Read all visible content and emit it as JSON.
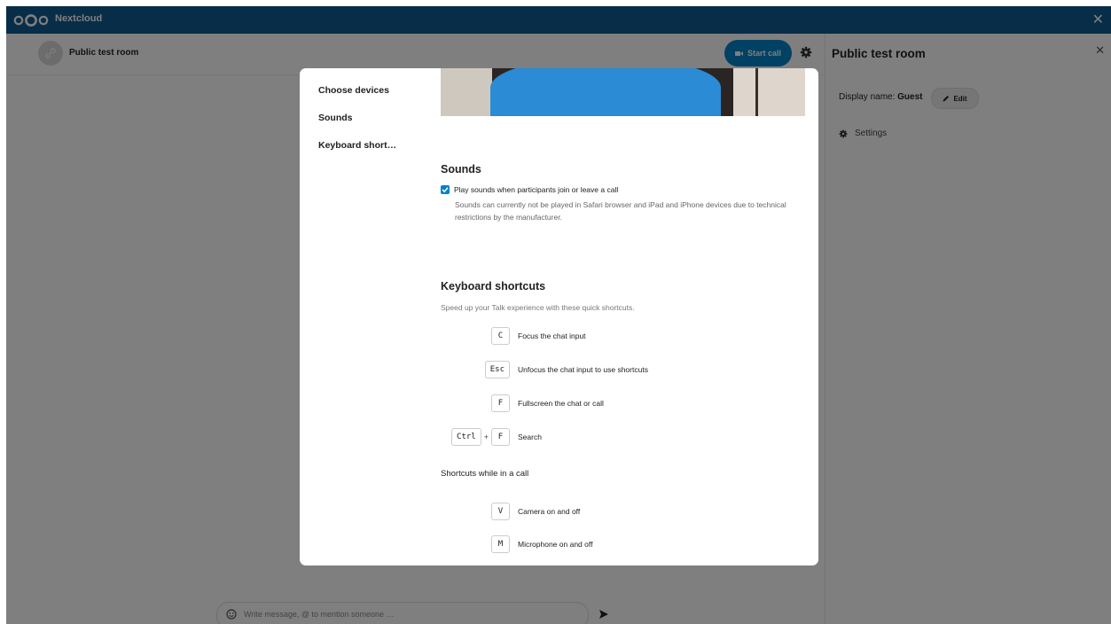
{
  "app": {
    "brand": "Nextcloud"
  },
  "chat": {
    "room_title": "Public test room",
    "start_call_label": "Start call",
    "input_placeholder": "Write message, @ to mention someone …"
  },
  "sidebar": {
    "title": "Public test room",
    "display_name_label": "Display name:",
    "display_name_value": "Guest",
    "edit_label": "Edit",
    "settings_label": "Settings"
  },
  "modal": {
    "nav": [
      {
        "label": "Choose devices"
      },
      {
        "label": "Sounds"
      },
      {
        "label": "Keyboard short…"
      }
    ],
    "sounds": {
      "heading": "Sounds",
      "checkbox_label": "Play sounds when participants join or leave a call",
      "checkbox_checked": true,
      "note": "Sounds can currently not be played in Safari browser and iPad and iPhone devices due to technical restrictions by the manufacturer."
    },
    "keyboard": {
      "heading": "Keyboard shortcuts",
      "description": "Speed up your Talk experience with these quick shortcuts.",
      "shortcuts": [
        {
          "keys": [
            "C"
          ],
          "description": "Focus the chat input"
        },
        {
          "keys": [
            "Esc"
          ],
          "description": "Unfocus the chat input to use shortcuts"
        },
        {
          "keys": [
            "F"
          ],
          "description": "Fullscreen the chat or call"
        },
        {
          "keys": [
            "Ctrl",
            "F"
          ],
          "joiner": "+",
          "description": "Search"
        }
      ],
      "call_heading": "Shortcuts while in a call",
      "call_shortcuts": [
        {
          "keys": [
            "V"
          ],
          "description": "Camera on and off"
        },
        {
          "keys": [
            "M"
          ],
          "description": "Microphone on and off"
        }
      ]
    }
  },
  "colors": {
    "header": "#0e5a91",
    "primary": "#0082c9"
  }
}
